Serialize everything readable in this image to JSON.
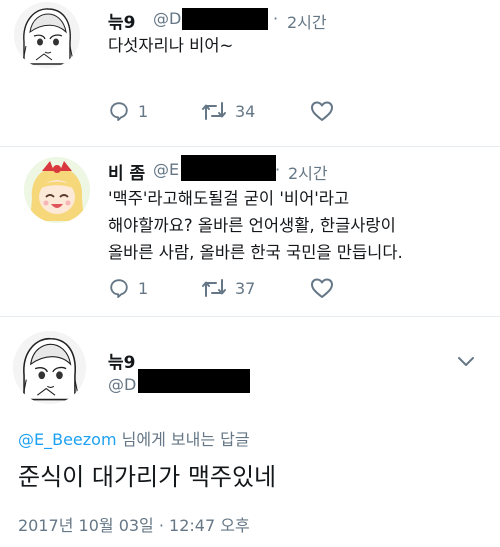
{
  "tweet1": {
    "name": "늒9",
    "handle": "@D",
    "time_sep": "·",
    "time": "2시간",
    "text": "다섯자리나 비어~",
    "reply_count": "1",
    "retweet_count": "34"
  },
  "tweet2": {
    "name": "비 좀",
    "handle": "@E",
    "time_sep": "·",
    "time": "2시간",
    "text_lines": [
      "'맥주'라고해도될걸 굳이 '비어'라고",
      "해야할까요? 올바른 언어생활, 한글사랑이",
      "올바른 사람, 올바른 한국 국민을 만듭니다."
    ],
    "reply_count": "1",
    "retweet_count": "37"
  },
  "tweet3": {
    "name": "늒9",
    "handle": "@D",
    "reply_to_mention": "@E_Beezom",
    "reply_to_suffix": " 님에게 보내는 답글",
    "text": "준식이 대가리가 맥주있네",
    "timestamp": "2017년 10월 03일 · 12:47 오후"
  },
  "colors": {
    "primary_text": "#14171a",
    "secondary_text": "#657786",
    "link": "#1da1f2",
    "divider": "#e6ecf0"
  },
  "icons": [
    "reply-icon",
    "retweet-icon",
    "like-icon",
    "chevron-down-icon"
  ]
}
